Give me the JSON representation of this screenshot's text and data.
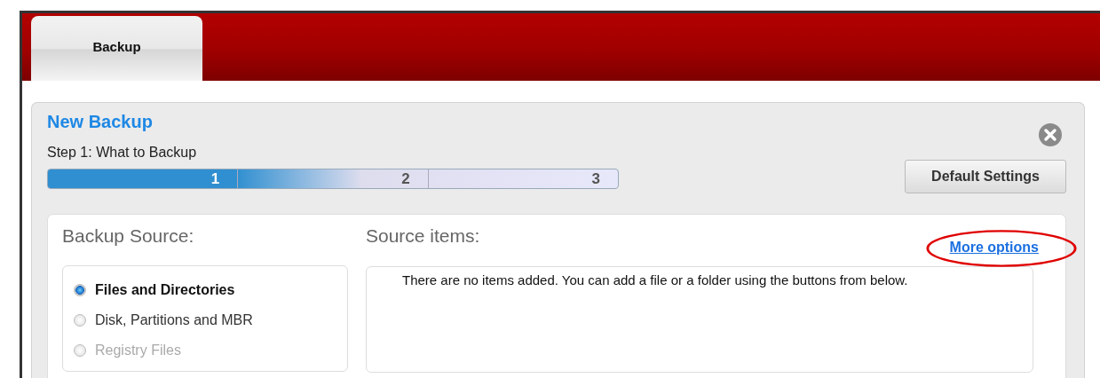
{
  "tabs": [
    {
      "label": "Backup",
      "selected": true
    }
  ],
  "panel": {
    "title": "New Backup",
    "step_label": "Step 1: What to Backup",
    "steps": [
      {
        "label": "1",
        "selected": true
      },
      {
        "label": "2",
        "selected": false
      },
      {
        "label": "3",
        "selected": false
      }
    ],
    "default_button": "Default Settings"
  },
  "source": {
    "heading": "Backup Source:",
    "options": [
      {
        "label": "Files and Directories",
        "selected": true,
        "disabled": false
      },
      {
        "label": "Disk, Partitions and MBR",
        "selected": false,
        "disabled": false
      },
      {
        "label": "Registry Files",
        "selected": false,
        "disabled": true
      }
    ]
  },
  "items": {
    "heading": "Source items:",
    "link": "More options",
    "link_highlighted": true,
    "empty_message": "There are no items added. You can add a file or a folder using the buttons from below."
  }
}
